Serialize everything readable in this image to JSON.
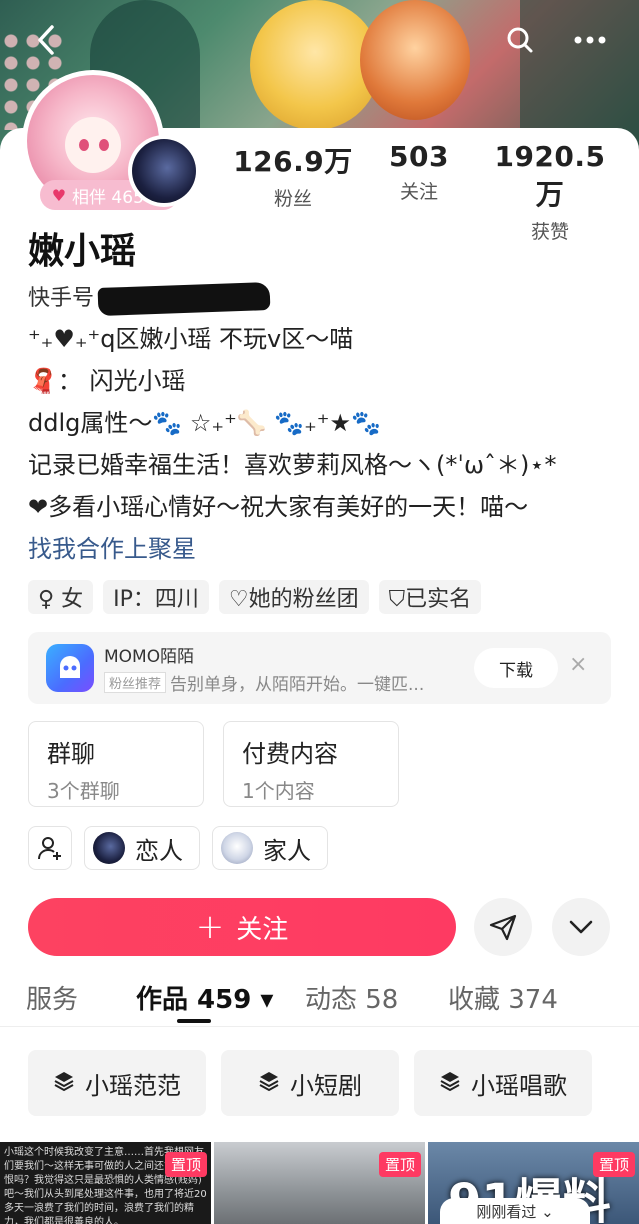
{
  "nav": {
    "back_icon": "chevron-left-icon",
    "search_icon": "search-icon",
    "more_icon": "more-dots-icon"
  },
  "profile": {
    "companion_badge": "相伴 465 天",
    "name": "嫩小瑶",
    "kuaishou_label": "快手号",
    "stats": [
      {
        "num": "126.9万",
        "label": "粉丝"
      },
      {
        "num": "503",
        "label": "关注"
      },
      {
        "num": "1920.5万",
        "label": "获赞"
      }
    ],
    "bio": [
      "⁺₊♥₊⁺q区嫩小瑶 不玩v区～喵",
      "🧣： 闪光小瑶",
      "ddlg属性～🐾 ☆₊⁺🦴 🐾₊⁺★🐾",
      "记录已婚幸福生活！喜欢萝莉风格～ヽ(*ˈωˆ＊)⋆*",
      "❤多看小瑶心情好～祝大家有美好的一天！喵～"
    ],
    "bio_link": "找我合作上聚星",
    "tags": [
      {
        "icon": "gender-female-icon",
        "label": "♀ 女"
      },
      {
        "icon": "",
        "label": "IP：四川"
      },
      {
        "icon": "heart-outline-icon",
        "label": "♡她的粉丝团"
      },
      {
        "icon": "shield-check-icon",
        "label": "⛉已实名"
      }
    ]
  },
  "ad": {
    "title": "MOMO陌陌",
    "badge": "粉丝推荐",
    "subtitle": "告别单身，从陌陌开始。一键匹...",
    "button": "下载",
    "close": "×"
  },
  "features": [
    {
      "title": "群聊",
      "sub": "3个群聊"
    },
    {
      "title": "付费内容",
      "sub": "1个内容"
    }
  ],
  "relations": [
    {
      "label": "恋人"
    },
    {
      "label": "家人"
    }
  ],
  "actions": {
    "follow_label": "关注",
    "follow_plus": "+"
  },
  "tabs": [
    {
      "label": "服务"
    },
    {
      "label": "作品 459 ▾"
    },
    {
      "label": "动态 58"
    },
    {
      "label": "收藏 374"
    }
  ],
  "collections": [
    {
      "label": "小瑶范范"
    },
    {
      "label": "小短剧"
    },
    {
      "label": "小瑶唱歌"
    }
  ],
  "thumbs": {
    "pin_label": "置顶",
    "thumb1_text": "小瑶这个时候我改变了主意……首先我想网友们要我们～这样无事可做的人之间还能产生仇恨吗？我觉得这只是最恐惧的人类情感(贱妈)吧～我们从头到尾处理这件事，也用了将近20多天一浪费了我们的时间，浪费了我们的精力，我们都是很善良的人。",
    "watermark": "91爆料",
    "watched_label": "刚刚看过 ⌄"
  }
}
